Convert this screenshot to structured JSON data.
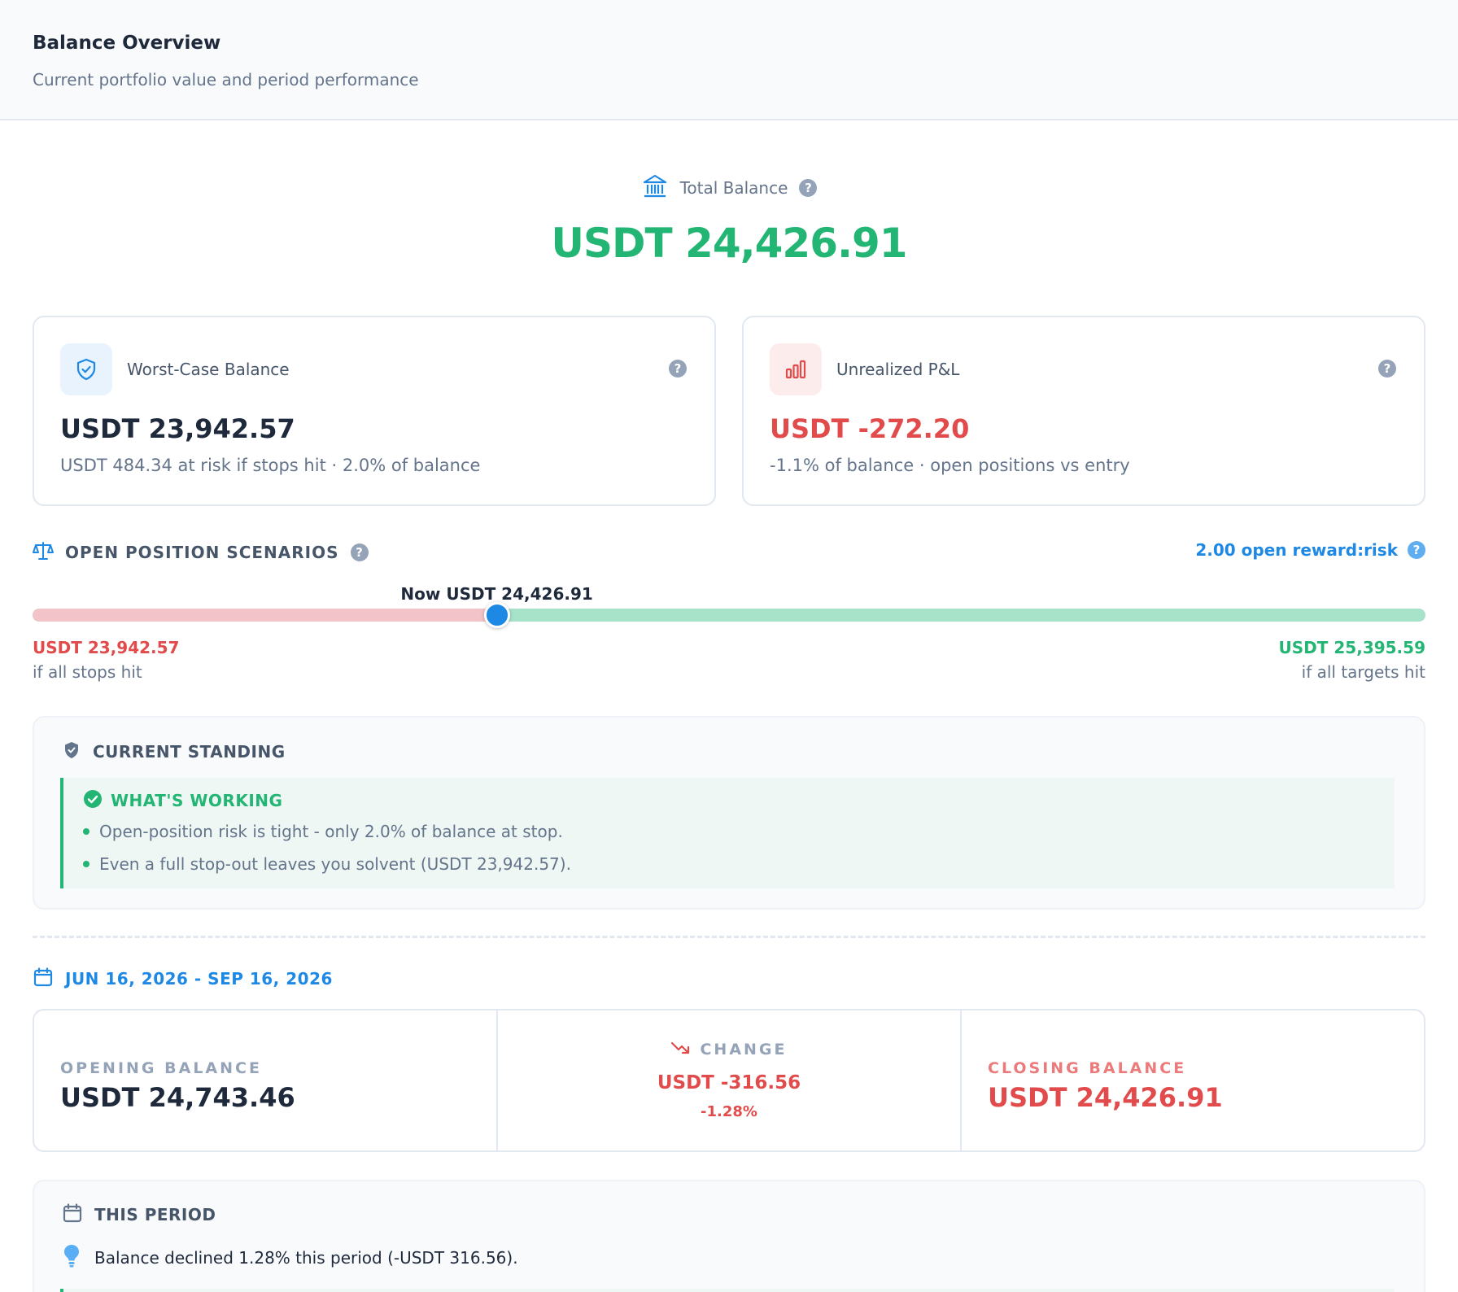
{
  "header": {
    "title": "Balance Overview",
    "subtitle": "Current portfolio value and period performance"
  },
  "total": {
    "icon": "bank-icon",
    "label": "Total Balance",
    "value": "USDT 24,426.91",
    "color": "#22b573"
  },
  "cards": {
    "worst_case": {
      "icon": "shield-check-icon",
      "label": "Worst-Case Balance",
      "value": "USDT 23,942.57",
      "description": "USDT 484.34 at risk if stops hit · 2.0% of balance"
    },
    "unrealized": {
      "icon": "bar-chart-icon",
      "label": "Unrealized P&L",
      "value": "USDT -272.20",
      "description": "-1.1% of balance · open positions vs entry",
      "color": "#e14b4b"
    }
  },
  "scenarios": {
    "icon": "scale-icon",
    "title": "OPEN POSITION SCENARIOS",
    "reward_risk": "2.00 open reward:risk",
    "now_label": "Now USDT 24,426.91",
    "now_fraction": 0.3333,
    "worst_value": "USDT 23,942.57",
    "worst_caption": "if all stops hit",
    "best_value": "USDT 25,395.59",
    "best_caption": "if all targets hit",
    "colors": {
      "loss": "#e14b4b",
      "gain": "#22b573",
      "thumb": "#1e88e5"
    }
  },
  "standing": {
    "icon": "shield-icon",
    "title": "CURRENT STANDING",
    "working_title": "WHAT'S WORKING",
    "working_icon": "check-circle-icon",
    "items": [
      "Open-position risk is tight - only 2.0% of balance at stop.",
      "Even a full stop-out leaves you solvent (USDT 23,942.57)."
    ]
  },
  "period": {
    "icon": "calendar-icon",
    "range": "JUN 16, 2026 - SEP 16, 2026",
    "opening_label": "OPENING BALANCE",
    "opening_value": "USDT 24,743.46",
    "change_icon": "trend-down-icon",
    "change_label": "CHANGE",
    "change_value": "USDT -316.56",
    "change_pct": "-1.28%",
    "closing_label": "CLOSING BALANCE",
    "closing_value": "USDT 24,426.91"
  },
  "this_period": {
    "icon": "calendar-icon",
    "title": "THIS PERIOD",
    "message_icon": "lightbulb-icon",
    "message": "Balance declined 1.28% this period (-USDT 316.56)."
  }
}
